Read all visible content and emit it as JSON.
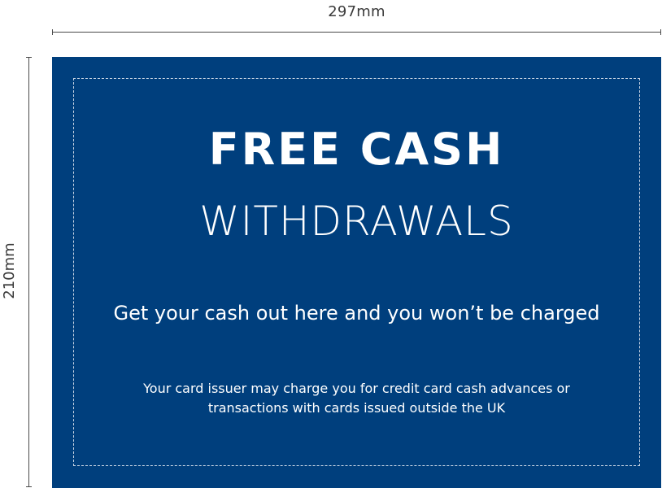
{
  "dimensions": {
    "width_label": "297mm",
    "height_label": "210mm"
  },
  "poster": {
    "headline": "FREE CASH",
    "subheadline": "WITHDRAWALS",
    "tagline": "Get your cash out here and you won’t be charged",
    "disclaimer": "Your card issuer may charge you for credit card cash advances or transactions with cards issued outside the UK",
    "colors": {
      "background": "#003f7d",
      "text": "#ffffff",
      "safe_area_border": "#c7d3e3"
    }
  }
}
